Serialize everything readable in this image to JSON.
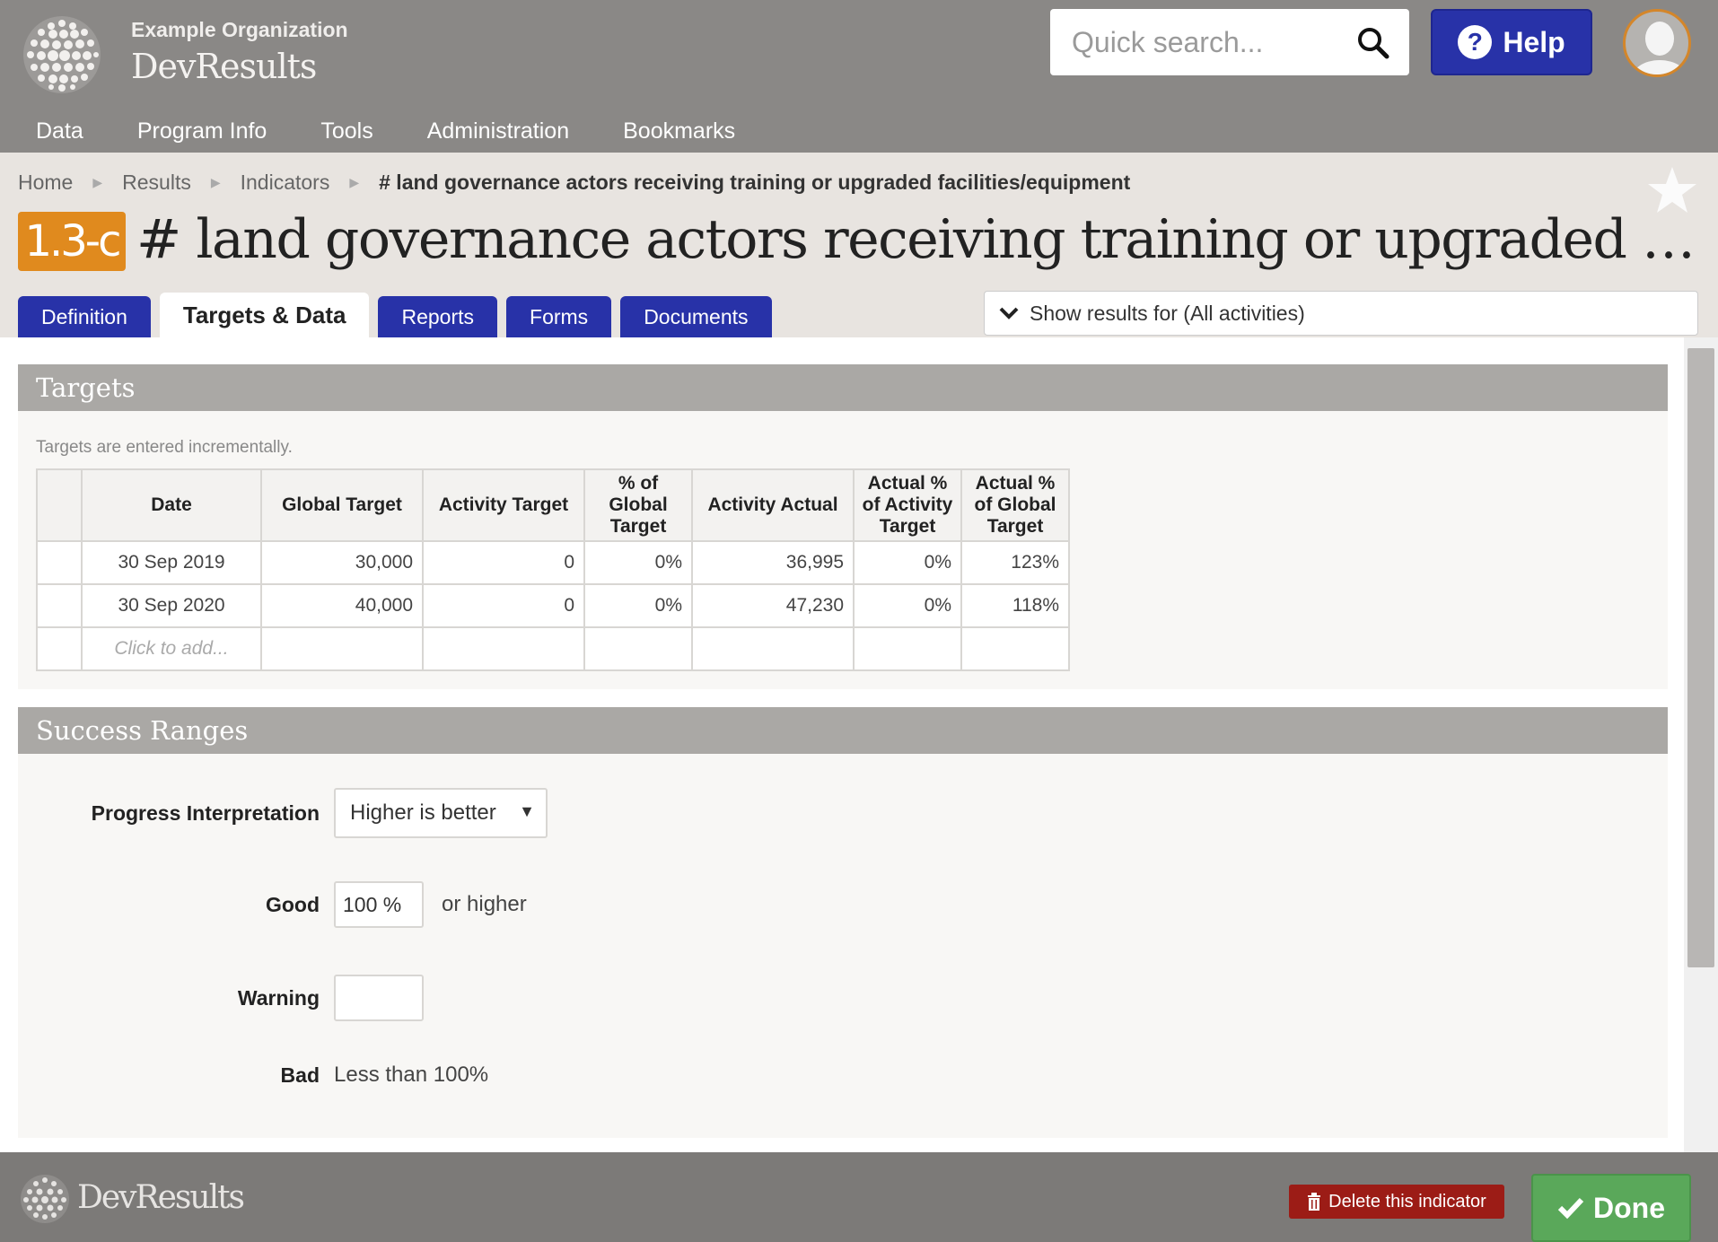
{
  "header": {
    "org_name": "Example Organization",
    "app_name": "DevResults",
    "search_placeholder": "Quick search...",
    "help_label": "Help"
  },
  "nav": [
    "Data",
    "Program Info",
    "Tools",
    "Administration",
    "Bookmarks"
  ],
  "breadcrumbs": {
    "home": "Home",
    "results": "Results",
    "indicators": "Indicators",
    "current": "# land governance actors receiving training or upgraded facilities/equipment"
  },
  "indicator": {
    "code": "1.3-c",
    "title": "# land governance actors receiving training or upgraded facilities/equipment"
  },
  "tabs": [
    "Definition",
    "Targets & Data",
    "Reports",
    "Forms",
    "Documents"
  ],
  "show_results": "Show results for (All activities)",
  "targets": {
    "heading": "Targets",
    "hint": "Targets are entered incrementally.",
    "columns": [
      "Date",
      "Global Target",
      "Activity Target",
      "% of Global Target",
      "Activity Actual",
      "Actual % of Activity Target",
      "Actual % of Global Target"
    ],
    "rows": [
      [
        "30 Sep 2019",
        "30,000",
        "0",
        "0%",
        "36,995",
        "0%",
        "123%"
      ],
      [
        "30 Sep 2020",
        "40,000",
        "0",
        "0%",
        "47,230",
        "0%",
        "118%"
      ]
    ],
    "add_placeholder": "Click to add..."
  },
  "success_ranges": {
    "heading": "Success Ranges",
    "progress_label": "Progress Interpretation",
    "progress_value": "Higher is better",
    "good_label": "Good",
    "good_value": "100 %",
    "good_suffix": "or higher",
    "warning_label": "Warning",
    "warning_value": "",
    "bad_label": "Bad",
    "bad_value": "Less than 100%"
  },
  "footer": {
    "app_name": "DevResults",
    "delete_label": "Delete this indicator",
    "done_label": "Done"
  },
  "colors": {
    "header_bg": "#8a8886",
    "tab_blue": "#2832a8",
    "badge_orange": "#e08a1e",
    "delete_red": "#9c1c16",
    "done_green": "#5aa85a"
  }
}
